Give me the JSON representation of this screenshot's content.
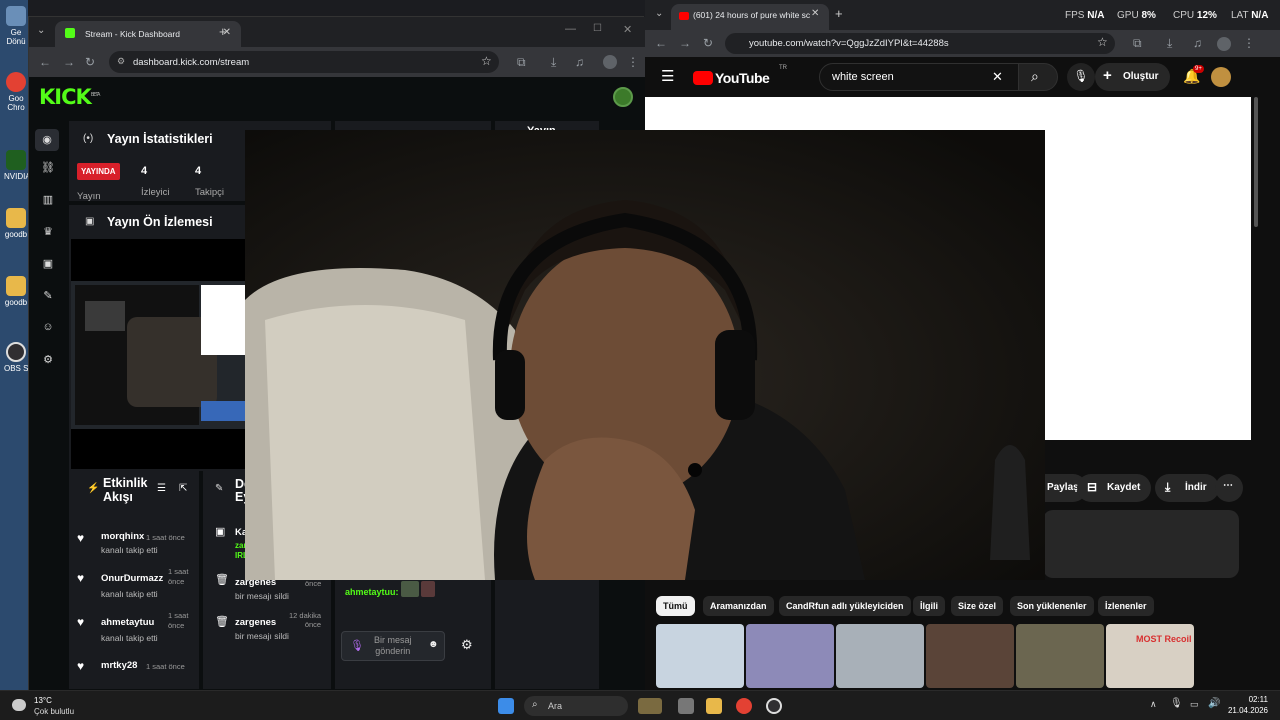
{
  "desktop": {
    "icons": [
      {
        "label": "Ge\nDönü"
      },
      {
        "label": "Goo\nChro"
      },
      {
        "label": "NVIDIA"
      },
      {
        "label": "goodb"
      },
      {
        "label": "goodb"
      },
      {
        "label": "OBS S"
      }
    ]
  },
  "kick_browser": {
    "tab_title": "Stream - Kick Dashboard",
    "url": "dashboard.kick.com/stream",
    "logo": "KICK",
    "logo_badge": "BETA",
    "stats_panel": {
      "title": "Yayın İstatistikleri",
      "live_badge": "YAYINDA",
      "live_sub": "Yayın",
      "viewers_value": "4",
      "viewers_label": "İzleyici",
      "followers_value": "4",
      "followers_label": "Takipçi",
      "col2_title": "Yayın"
    },
    "preview_panel": {
      "title": "Yayın Ön İzlemesi"
    },
    "activity_panel": {
      "title_line1": "Etkinlik",
      "title_line2": "Akışı",
      "events": [
        {
          "user": "morqhinx",
          "time": "1 saat önce",
          "action": "kanalı takip etti"
        },
        {
          "user": "OnurDurmazz",
          "time": "1 saat\nönce",
          "action": "kanalı takip etti"
        },
        {
          "user": "ahmetaytuu",
          "time": "1 saat\nönce",
          "action": "kanalı takip etti"
        },
        {
          "user": "mrtky28",
          "time": "1 saat önce",
          "action": ""
        }
      ]
    },
    "mod_panel": {
      "title_line1": "De",
      "title_line2": "Ey",
      "rows": [
        {
          "user": "Ka",
          "action": "zar\nIRL",
          "time": ""
        },
        {
          "user": "zargenes",
          "action": "bir mesajı sildi",
          "time": "önce"
        },
        {
          "user": "zargenes",
          "action": "bir mesajı sildi",
          "time": "12 dakika\nönce"
        }
      ]
    },
    "chat": {
      "last_user": "ahmetaytuu:",
      "input_placeholder": "Bir mesaj\ngönderin"
    }
  },
  "youtube_browser": {
    "tab_title": "(601) 24 hours of pure white sc",
    "stats": {
      "fps_label": "FPS",
      "fps": "N/A",
      "gpu_label": "GPU",
      "gpu": "8%",
      "cpu_label": "CPU",
      "cpu": "12%",
      "lat_label": "LAT",
      "lat": "N/A"
    },
    "url": "youtube.com/watch?v=QggJzZdIYPI&t=44288s",
    "logo": "YouTube",
    "logo_region": "TR",
    "search_value": "white screen",
    "create_label": "Oluştur",
    "notif_badge": "9+",
    "actions": {
      "share": "Paylaş",
      "save": "Kaydet",
      "download": "İndir"
    },
    "chips": [
      "Tümü",
      "Aramanızdan",
      "CandRfun adlı yükleyiciden",
      "İlgili",
      "Size özel",
      "Son yüklenenler",
      "İzlenenler"
    ],
    "thumb_texts": [
      "MOST Recoil"
    ]
  },
  "taskbar": {
    "weather_temp": "13°C",
    "weather_desc": "Çok bulutlu",
    "search_placeholder": "Ara",
    "time": "02:11",
    "date": "21.04.2026"
  },
  "colors": {
    "kick_green": "#53fc18",
    "live_red": "#d8202a",
    "yt_red": "#ff0000",
    "panel_bg": "#191b1f"
  }
}
